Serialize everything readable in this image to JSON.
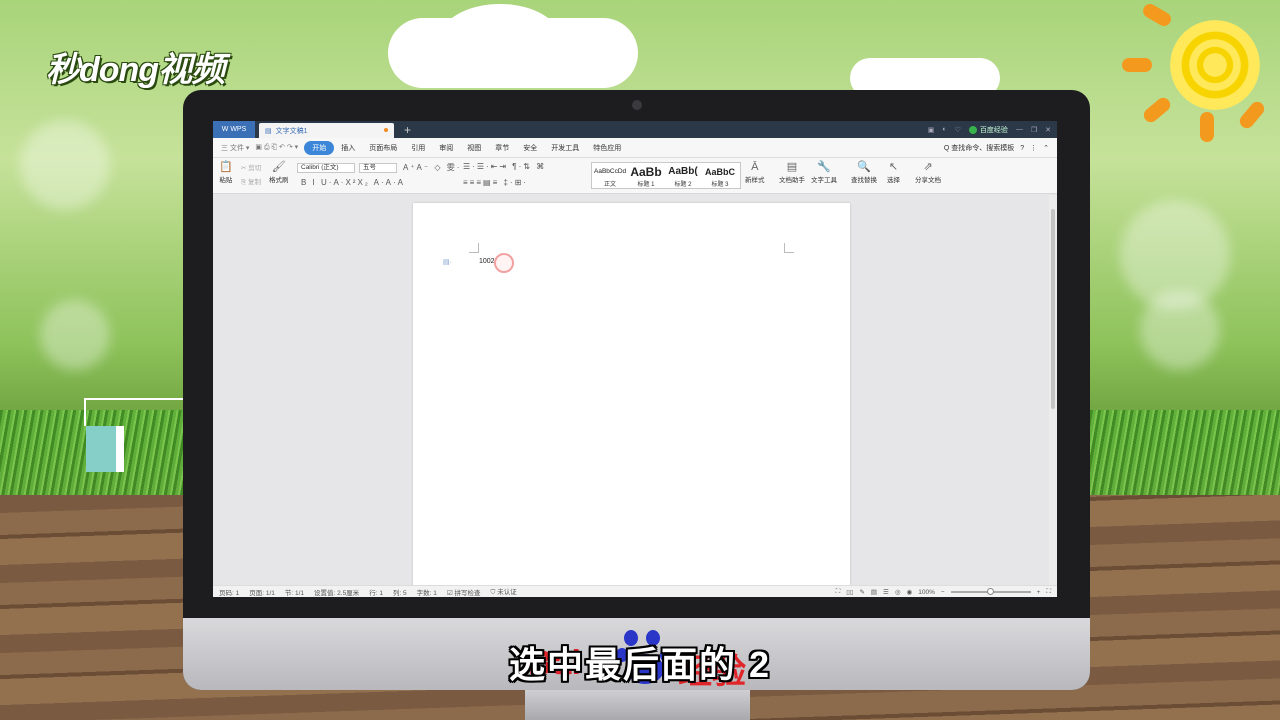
{
  "branding": {
    "logo_text": "秒dong视频"
  },
  "subtitle": "选中最后面的 2",
  "watermark": {
    "left_text": "Bai",
    "right_text": "经验"
  },
  "app": {
    "tabs": {
      "wps_label": "WPS",
      "doc_label": "文字文稿1",
      "add": "+"
    },
    "window": {
      "login": "百度经验"
    },
    "menu": {
      "file": "三 文件 ▾",
      "items": [
        "开始",
        "插入",
        "页面布局",
        "引用",
        "审阅",
        "视图",
        "章节",
        "安全",
        "开发工具",
        "特色应用"
      ],
      "search": "Q 查找命令、搜索模板",
      "help": "?"
    },
    "ribbon": {
      "paste": "粘贴",
      "cut": "剪切",
      "copy": "复制",
      "format_painter": "格式刷",
      "font_name": "Calibri (正文)",
      "font_size": "五号",
      "styles": [
        {
          "preview": "AaBbCcDd",
          "name": "正文"
        },
        {
          "preview": "AaBb",
          "name": "标题 1"
        },
        {
          "preview": "AaBb(",
          "name": "标题 2"
        },
        {
          "preview": "AaBbC",
          "name": "标题 3"
        }
      ],
      "new_style": "新样式",
      "doc_helper": "文档助手",
      "text_tools": "文字工具",
      "find_replace": "查找替换",
      "select": "选择",
      "share": "分享文档"
    },
    "document": {
      "text": "1002"
    },
    "status": {
      "page_num": "页码: 1",
      "pages": "页面: 1/1",
      "section": "节: 1/1",
      "setting": "设置值: 2.5厘米",
      "row": "行: 1",
      "col": "列: 5",
      "words": "字数: 1",
      "spell": "拼写检查",
      "cert": "未认证",
      "zoom": "100%"
    }
  }
}
